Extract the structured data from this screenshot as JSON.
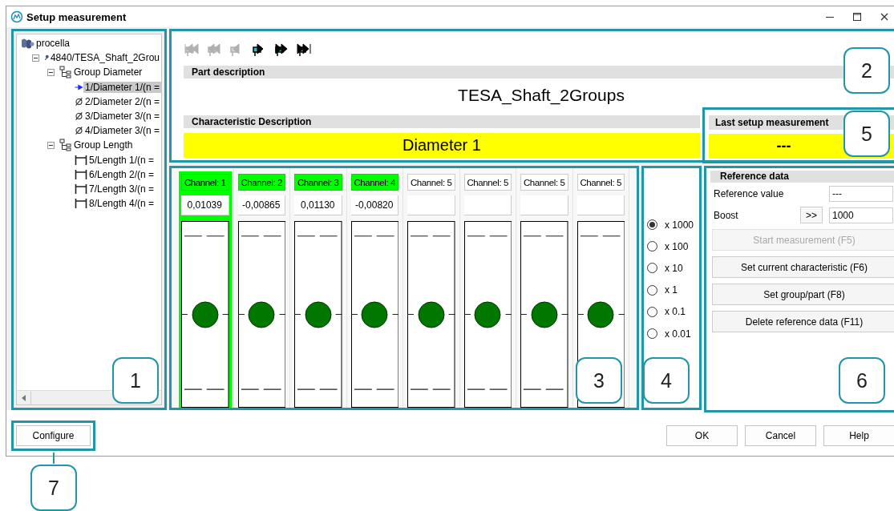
{
  "window": {
    "title": "Setup measurement"
  },
  "tree": {
    "label": "procella",
    "kind": "root",
    "selected": false,
    "children": [
      {
        "label": "4840/TESA_Shaft_2Grou",
        "kind": "part",
        "selected": false,
        "expanded": true,
        "children": [
          {
            "label": "Group Diameter",
            "kind": "group",
            "selected": false,
            "expanded": true,
            "children": [
              {
                "label": "1/Diameter 1/(n =",
                "kind": "current",
                "selected": true
              },
              {
                "label": "2/Diameter 2/(n =",
                "kind": "diameter",
                "selected": false
              },
              {
                "label": "3/Diameter 3/(n =",
                "kind": "diameter",
                "selected": false
              },
              {
                "label": "4/Diameter 3/(n =",
                "kind": "diameter",
                "selected": false
              }
            ]
          },
          {
            "label": "Group Length",
            "kind": "group",
            "selected": false,
            "expanded": true,
            "children": [
              {
                "label": "5/Length 1/(n =",
                "kind": "length",
                "selected": false
              },
              {
                "label": "6/Length 2/(n =",
                "kind": "length",
                "selected": false
              },
              {
                "label": "7/Length 3/(n =",
                "kind": "length",
                "selected": false
              },
              {
                "label": "8/Length 4/(n =",
                "kind": "length",
                "selected": false
              }
            ]
          }
        ]
      }
    ]
  },
  "toolbar": [
    {
      "kind": "first",
      "disabled": true
    },
    {
      "kind": "previous",
      "disabled": true
    },
    {
      "kind": "back",
      "disabled": true
    },
    {
      "kind": "forward",
      "disabled": false
    },
    {
      "kind": "next",
      "disabled": false
    },
    {
      "kind": "last",
      "disabled": false
    }
  ],
  "part_description": {
    "heading": "Part description",
    "value": "TESA_Shaft_2Groups"
  },
  "characteristic": {
    "heading": "Characteristic Description",
    "value": "Diameter 1"
  },
  "last_setup": {
    "heading": "Last setup measurement",
    "value": "---"
  },
  "channels": [
    {
      "label": "Channel: 1",
      "value": "0,01039",
      "active": true,
      "selected": true
    },
    {
      "label": "Channel: 2",
      "value": "-0,00865",
      "active": true,
      "selected": false
    },
    {
      "label": "Channel: 3",
      "value": "0,01130",
      "active": true,
      "selected": false
    },
    {
      "label": "Channel: 4",
      "value": "-0,00820",
      "active": true,
      "selected": false
    },
    {
      "label": "Channel: 5",
      "active": false,
      "selected": false
    },
    {
      "label": "Channel: 5",
      "active": false,
      "selected": false
    },
    {
      "label": "Channel: 5",
      "active": false,
      "selected": false
    },
    {
      "label": "Channel: 5",
      "active": false,
      "selected": false
    }
  ],
  "scale_options": [
    {
      "label": "x 1000",
      "selected": true
    },
    {
      "label": "x 100",
      "selected": false
    },
    {
      "label": "x 10",
      "selected": false
    },
    {
      "label": "x 1",
      "selected": false
    },
    {
      "label": "x 0.1",
      "selected": false
    },
    {
      "label": "x 0.01",
      "selected": false
    }
  ],
  "reference": {
    "heading": "Reference data",
    "reference_value": {
      "label": "Reference value",
      "value": "---"
    },
    "boost": {
      "label": "Boost",
      "button": ">>",
      "value": "1000"
    },
    "buttons": [
      {
        "label": "Start measurement (F5)",
        "disabled": true
      },
      {
        "label": "Set current characteristic (F6)",
        "disabled": false
      },
      {
        "label": "Set group/part (F8)",
        "disabled": false
      },
      {
        "label": "Delete reference data (F11)",
        "disabled": false
      }
    ]
  },
  "footer": {
    "configure": "Configure",
    "buttons": [
      "OK",
      "Cancel",
      "Help"
    ]
  },
  "callouts": [
    "1",
    "2",
    "3",
    "4",
    "5",
    "6",
    "7"
  ]
}
